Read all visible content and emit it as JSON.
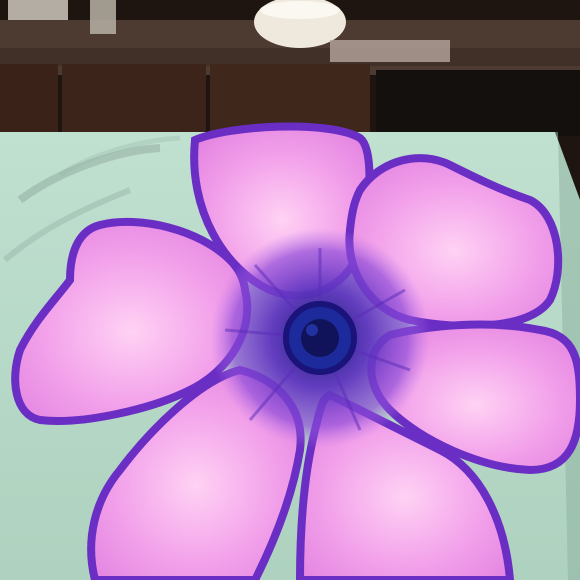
{
  "scene": {
    "subject": "painted-flower-canvas",
    "setting": "kitchen-counter"
  },
  "palette": {
    "background_dark": "#2a1d16",
    "cabinet_wood": "#4a2d20",
    "countertop": "#5a4236",
    "canvas_base": "#b7d8c6",
    "canvas_shadow": "#8fb2a2",
    "petal_fill": "#f29ae8",
    "petal_highlight": "#ffc2f3",
    "petal_outline": "#6b2ec4",
    "center_dark": "#3c2f9f",
    "center_mid": "#7d3dcb",
    "center_core": "#1b1f8f",
    "core_highlight": "#2f46d0"
  },
  "objects": {
    "bowl": "colander-bowl",
    "canister": "canister",
    "appliance": "dishwasher"
  }
}
